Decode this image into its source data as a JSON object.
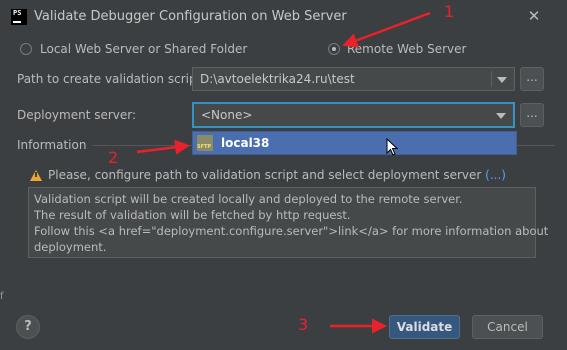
{
  "window": {
    "app_icon_text": "PS",
    "title": "Validate Debugger Configuration on Web Server",
    "close_glyph": "✕"
  },
  "mode": {
    "options": [
      {
        "label": "Local Web Server or Shared Folder",
        "selected": false
      },
      {
        "label": "Remote Web Server",
        "selected": true
      }
    ]
  },
  "path_field": {
    "label": "Path to create validation script:",
    "value": "D:\\avtoelektrika24.ru\\test",
    "browse_label": "..."
  },
  "deployment": {
    "label": "Deployment server:",
    "value": "<None>",
    "browse_label": "...",
    "dropdown_items": [
      {
        "label": "local38",
        "icon": "sftp-icon",
        "icon_text": "SFTP"
      }
    ]
  },
  "information": {
    "heading": "Information",
    "warning_text": "Please, configure path to validation script and select deployment server",
    "warning_link": "(...)",
    "details": [
      "Validation script will be created locally and deployed to the remote server.",
      "The result of validation will be fetched by http request.",
      "Follow this <a href=\"deployment.configure.server\">link</a> for more information about",
      "deployment."
    ]
  },
  "footer": {
    "help_label": "?",
    "validate_label": "Validate",
    "cancel_label": "Cancel"
  },
  "annotations": {
    "marker_1": "1",
    "marker_2": "2",
    "marker_3": "3",
    "color": "#e8222a"
  },
  "colors": {
    "background": "#3c3f41",
    "accent": "#4b6eaf",
    "focus": "#3592c4",
    "warning": "#f0a732",
    "link": "#589df6"
  },
  "side_glyph": "f"
}
